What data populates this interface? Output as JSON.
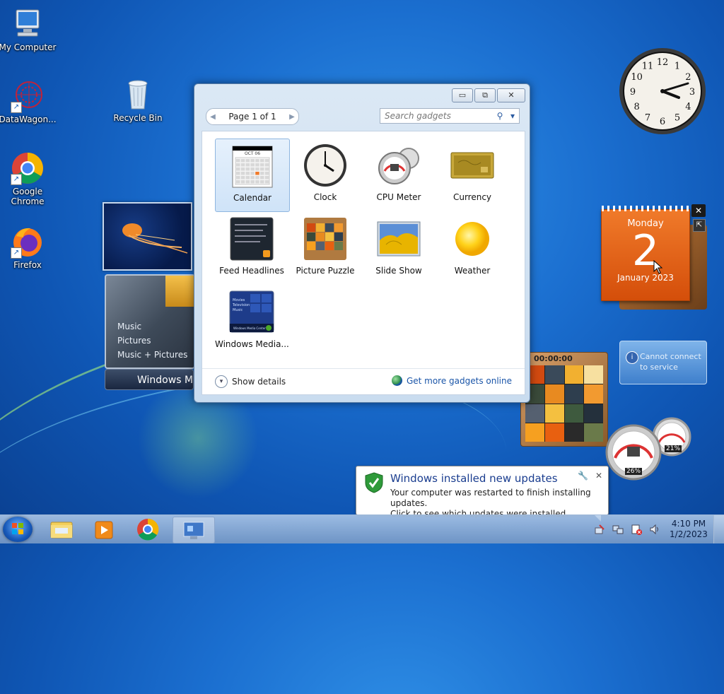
{
  "desktop": {
    "icons": [
      {
        "label": "My Computer"
      },
      {
        "label": "Recycle Bin"
      },
      {
        "label": "DataWagon..."
      },
      {
        "label": "Google Chrome"
      },
      {
        "label": "Firefox"
      }
    ],
    "clock_gadget": {
      "numerals": [
        "12",
        "1",
        "2",
        "3",
        "4",
        "5",
        "6",
        "7",
        "8",
        "9",
        "10",
        "11"
      ],
      "time": "4:10"
    },
    "calendar_gadget": {
      "weekday": "Monday",
      "day": "2",
      "month_year": "January 2023",
      "close": "✕"
    },
    "weather_gadget": {
      "message": "Cannot connect to service"
    },
    "media_center_gadget": {
      "items": [
        "Music",
        "Pictures",
        "Music + Pictures"
      ],
      "title": "Windows Me"
    },
    "puzzle_gadget": {
      "timer": "00:00:00"
    },
    "cpu_gadget": {
      "cpu": "26%",
      "memory": "21%"
    }
  },
  "gallery": {
    "pager": {
      "label": "Page 1 of 1",
      "prev": "◀",
      "next": "▶"
    },
    "search": {
      "placeholder": "Search gadgets"
    },
    "window_buttons": {
      "minimize": "▭",
      "restore": "⧉",
      "close": "✕"
    },
    "gadgets": [
      {
        "name": "Calendar",
        "icon": "calendar-icon",
        "selected": true
      },
      {
        "name": "Clock",
        "icon": "clock-icon"
      },
      {
        "name": "CPU Meter",
        "icon": "cpu-meter-icon"
      },
      {
        "name": "Currency",
        "icon": "currency-icon"
      },
      {
        "name": "Feed Headlines",
        "icon": "feed-icon"
      },
      {
        "name": "Picture Puzzle",
        "icon": "puzzle-icon"
      },
      {
        "name": "Slide Show",
        "icon": "slideshow-icon"
      },
      {
        "name": "Weather",
        "icon": "weather-icon"
      },
      {
        "name": "Windows Media...",
        "icon": "media-center-icon"
      }
    ],
    "calendar_thumb": {
      "month": "OCT 06"
    },
    "media_thumb": {
      "lines": [
        "Movies",
        "Television",
        "Music"
      ],
      "footer": "Windows Media Center"
    },
    "footer": {
      "details": "Show details",
      "online": "Get more gadgets online"
    }
  },
  "notification": {
    "title": "Windows installed new updates",
    "line1": "Your computer was restarted to finish installing updates.",
    "line2": "Click to see which updates were installed."
  },
  "taskbar": {
    "time": "4:10 PM",
    "date": "1/2/2023"
  },
  "colors": {
    "calendar_orange": "#e05a10",
    "selection_blue": "#cfe3f8",
    "link_blue": "#1a55a8"
  }
}
